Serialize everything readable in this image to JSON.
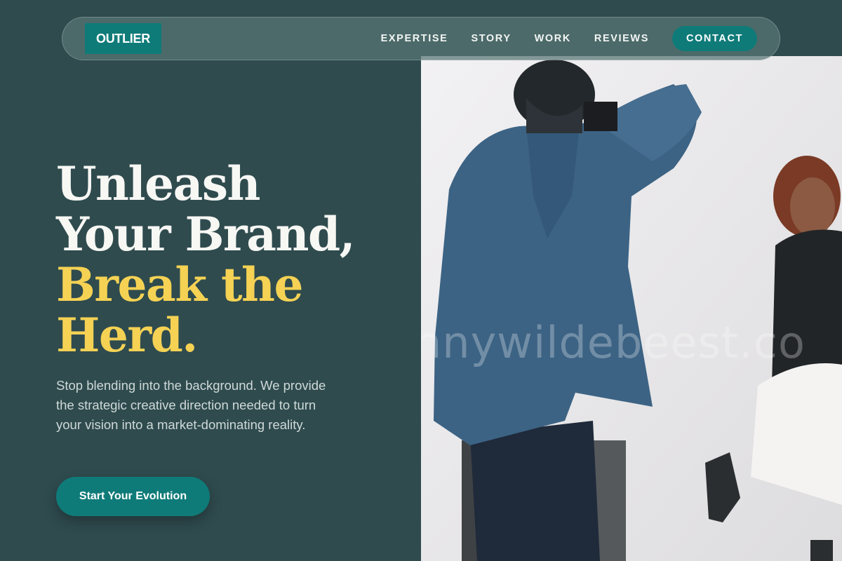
{
  "brand": {
    "logo_text": "OUTLIER"
  },
  "nav": {
    "links": [
      "EXPERTISE",
      "STORY",
      "WORK",
      "REVIEWS"
    ],
    "contact_label": "CONTACT"
  },
  "hero": {
    "headline_line1": "Unleash",
    "headline_line2": "Your Brand,",
    "headline_line3": "Break the",
    "headline_line4": "Herd.",
    "description": "Stop blending into the background. We provide the strategic creative direction needed to turn your vision into a market-dominating reality.",
    "cta_label": "Start Your Evolution",
    "image_watermark": "nnywildebeest.co"
  },
  "colors": {
    "background": "#2f4b4e",
    "accent": "#0f7b79",
    "highlight": "#f5d254"
  }
}
